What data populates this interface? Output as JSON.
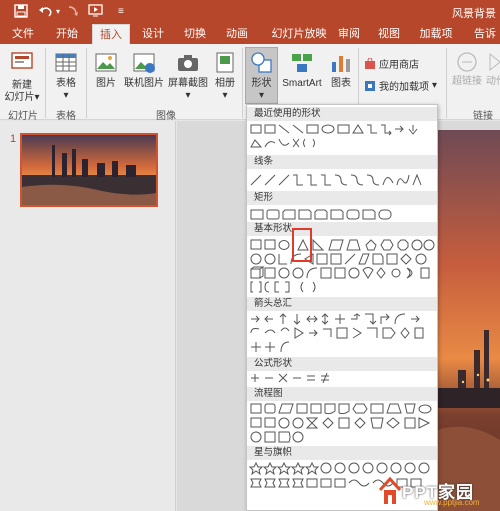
{
  "window": {
    "title": "风景背景"
  },
  "tabs": [
    "文件",
    "开始",
    "插入",
    "设计",
    "切换",
    "动画",
    "幻灯片放映",
    "审阅",
    "视图",
    "加载项",
    "告诉"
  ],
  "active_tab": "插入",
  "ribbon": {
    "new_slide": "新建\n幻灯片",
    "new_slide_l1": "新建",
    "new_slide_l2": "幻灯片",
    "table": "表格",
    "picture": "图片",
    "online_picture": "联机图片",
    "screenshot": "屏幕截图",
    "album": "相册",
    "shapes": "形状",
    "smartart": "SmartArt",
    "chart": "图表",
    "app_store": "应用商店",
    "my_addins": "我的加载项",
    "hyperlink": "超链接",
    "action": "动作",
    "groups": {
      "slides": "幻灯片",
      "tables": "表格",
      "images": "图像",
      "links": "链接"
    }
  },
  "slides_panel": {
    "slide_number": "1"
  },
  "shapes_menu": {
    "sections": [
      "最近使用的形状",
      "线条",
      "矩形",
      "基本形状",
      "箭头总汇",
      "公式形状",
      "流程图",
      "星与旗帜"
    ]
  },
  "watermark": {
    "text": "PPT家园",
    "url": "www.pptjia.com"
  },
  "colors": {
    "accent": "#b7472a",
    "highlight": "#e03a2d"
  }
}
